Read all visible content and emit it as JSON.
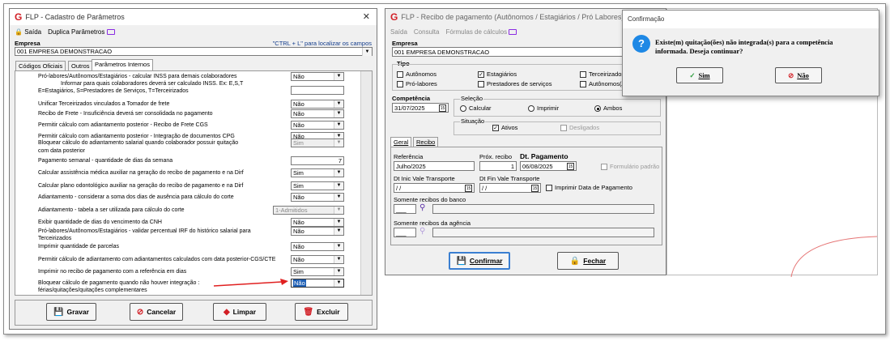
{
  "left": {
    "title": "FLP - Cadastro de Parâmetros",
    "close_glyph": "✕",
    "menu": {
      "saida": "Saída",
      "duplica": "Duplica Parâmetros"
    },
    "empresa_label": "Empresa",
    "ctrl_hint": "\"CTRL + L\" para localizar os campos",
    "empresa_value": "001 EMPRESA DEMONSTRACAO",
    "tabs": [
      "Códigos Oficiais",
      "Outros",
      "Parâmetros Internos"
    ],
    "params": [
      {
        "label": "Pró-labores/Autônomos/Estagiários - calcular INSS para demais colaboradores",
        "value": "Não"
      },
      {
        "label": "Informar para quais colaboradores deverá ser calculado INSS. Ex: E,S,T",
        "value": ""
      },
      {
        "label": "E=Estagiários, S=Prestadores de Serviços, T=Terceirizados",
        "value": ""
      },
      {
        "label": "Unificar Terceirizados vinculados a Tomador de frete",
        "value": "Não"
      },
      {
        "label": "Recibo de Frete - Insuficiência deverá ser consolidada no pagamento",
        "value": "Não"
      },
      {
        "label": "Permitir cálculo com adiantamento posterior - Recibo de Frete CGS",
        "value": "Não"
      },
      {
        "label": "Permitir cálculo com adiantamento posterior - Integração de documentos CPG",
        "value": "Não"
      },
      {
        "label": "Bloquear cálculo do adiantamento salarial quando colaborador possuir quitação",
        "value": "Sim"
      },
      {
        "label": "com data posterior",
        "value": ""
      },
      {
        "label": "Pagamento semanal - quantidade de dias da semana",
        "value": "7"
      },
      {
        "label": "Calcular assistência médica auxiliar na geração do recibo de pagamento e na Dirf",
        "value": "Sim"
      },
      {
        "label": "Calcular plano odontológico auxiliar na geração do recibo de pagamento e na Dirf",
        "value": "Sim"
      },
      {
        "label": "Adiantamento - considerar a soma dos dias de ausência para cálculo do corte",
        "value": "Não"
      },
      {
        "label": "Adiantamento - tabela a ser utilizada para cálculo do corte",
        "value": "1-Admitidos"
      },
      {
        "label": "Exibir quantidade de dias do vencimento da CNH",
        "value": "Não"
      },
      {
        "label": "Pró-labores/Autônomos/Estagiários - validar percentual IRF do  histórico salarial para",
        "value": "Não"
      },
      {
        "label": "Terceirizados",
        "value": ""
      },
      {
        "label": "Imprimir quantidade de parcelas",
        "value": "Não"
      },
      {
        "label": "Permitir cálculo de adiantamento com adiantamentos calculados com data posterior-CGS/CTE",
        "value": "Não"
      },
      {
        "label": "Imprimir no recibo de pagamento com a referência em dias",
        "value": "Sim"
      },
      {
        "label": "Bloquear cálculo de pagamento quando não houver integração :",
        "value": "Não"
      },
      {
        "label": "férias/quitações/quitações complementares",
        "value": ""
      }
    ],
    "buttons": {
      "gravar": "Gravar",
      "cancelar": "Cancelar",
      "limpar": "Limpar",
      "excluir": "Excluir"
    }
  },
  "right": {
    "title": "FLP - Recibo de pagamento (Autônomos / Estagiários / Pró Labores)",
    "menu": {
      "saida": "Saída",
      "consulta": "Consulta",
      "formulas": "Fórmulas de cálculos"
    },
    "empresa_label": "Empresa",
    "empresa_value": "001 EMPRESA DEMONSTRACAO",
    "tipo_label": "Tipo",
    "tipo": {
      "autonomos": "Autônomos",
      "estagiarios": "Estagiários",
      "terceirizados": "Terceirizados",
      "prolabores": "Pró-labores",
      "prestadores": "Prestadores de serviços",
      "autonomos_a": "Autônomos(A"
    },
    "competencia_label": "Competência",
    "competencia_value": "31/07/2025",
    "selecao_label": "Seleção",
    "selecao": {
      "calcular": "Calcular",
      "imprimir": "Imprimir",
      "ambos": "Ambos"
    },
    "situacao_label": "Situação",
    "situacao": {
      "ativos": "Ativos",
      "desligados": "Desligados"
    },
    "tabs": [
      "Geral",
      "Recibo"
    ],
    "referencia_label": "Referência",
    "referencia_value": "Julho/2025",
    "prox_recibo_label": "Próx. recibo",
    "prox_recibo_value": "1",
    "dt_pagamento_label": "Dt. Pagamento",
    "dt_pagamento_value": "06/08/2025",
    "formulario_padrao": "Formulário padrão",
    "dt_inic_label": "Dt Inic Vale Transporte",
    "dt_fin_label": "Dt Fin Vale Transporte",
    "date_empty": " / /",
    "imprimir_data": "Imprimir Data de Pagamento",
    "banco_label": "Somente recibos do banco",
    "agencia_label": "Somente recibos da agência",
    "field_empty": "___",
    "confirmar": "Confirmar",
    "fechar": "Fechar"
  },
  "dialog": {
    "title": "Confirmação",
    "message_line1": "Existe(m) quitação(ões) não integrada(s) para a competência",
    "message_line2": "informada. Deseja continuar?",
    "sim": "Sim",
    "nao": "Não"
  },
  "colors": {
    "accent_red": "#d21f26",
    "blue": "#1e88e5",
    "arrow": "#e02020"
  }
}
